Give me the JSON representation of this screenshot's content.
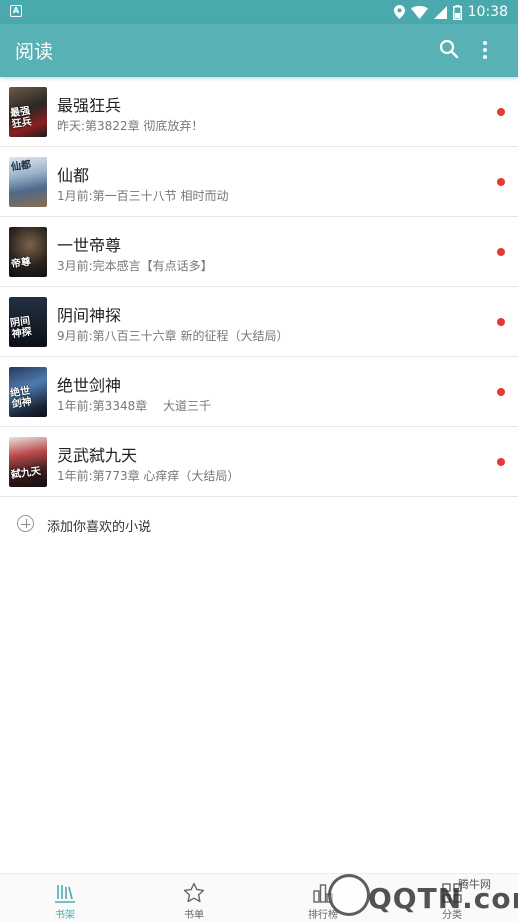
{
  "status_bar": {
    "left_icon_letter": "A",
    "time": "10:38",
    "icons": [
      "location-icon",
      "wifi-icon",
      "signal-icon",
      "battery-icon"
    ]
  },
  "toolbar": {
    "title": "阅读",
    "search_icon": "search-icon",
    "more_icon": "more-vert-icon"
  },
  "books": [
    {
      "title": "最强狂兵",
      "subtitle": "昨天:第3822章 彻底放弃！",
      "cover_text": "最强\n狂兵",
      "unread": true
    },
    {
      "title": "仙都",
      "subtitle": "1月前:第一百三十八节 相时而动",
      "cover_text": "仙都",
      "unread": true
    },
    {
      "title": "一世帝尊",
      "subtitle": "3月前:完本感言【有点话多】",
      "cover_text": "帝尊",
      "unread": true
    },
    {
      "title": "阴间神探",
      "subtitle": "9月前:第八百三十六章 新的征程（大结局）",
      "cover_text": "阴间\n神探",
      "unread": true
    },
    {
      "title": "绝世剑神",
      "subtitle": "1年前:第3348章　 大道三千",
      "cover_text": "绝世\n剑神",
      "unread": true
    },
    {
      "title": "灵武弑九天",
      "subtitle": "1年前:第773章 心痒痒（大结局）",
      "cover_text": "弑九天",
      "unread": true
    }
  ],
  "add_novel_label": "添加你喜欢的小说",
  "bottom_nav": [
    {
      "label": "书架",
      "icon": "bookshelf-icon",
      "active": true
    },
    {
      "label": "书单",
      "icon": "star-icon",
      "active": false
    },
    {
      "label": "排行榜",
      "icon": "ranking-icon",
      "active": false
    },
    {
      "label": "分类",
      "icon": "category-icon",
      "active": false
    }
  ],
  "watermark": {
    "brand": "QQTN.com",
    "cn": "腾牛网"
  },
  "colors": {
    "primary": "#58b1b4",
    "status_bar": "#4aa9ac",
    "unread_dot": "#e53935"
  }
}
